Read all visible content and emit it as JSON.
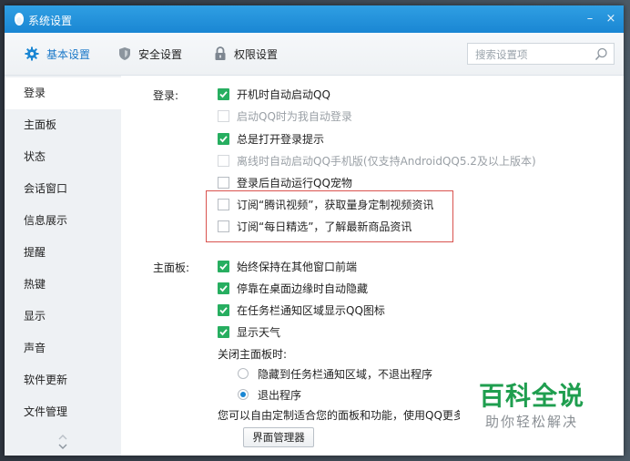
{
  "window": {
    "title": "系统设置",
    "minimize_glyph": "–",
    "close_glyph": "×"
  },
  "tabs": [
    {
      "label": "基本设置",
      "icon": "gear-icon",
      "active": true
    },
    {
      "label": "安全设置",
      "icon": "shield-icon",
      "active": false
    },
    {
      "label": "权限设置",
      "icon": "lock-icon",
      "active": false
    }
  ],
  "search": {
    "placeholder": "搜索设置项",
    "value": ""
  },
  "sidebar": {
    "items": [
      {
        "label": "登录",
        "active": true
      },
      {
        "label": "主面板"
      },
      {
        "label": "状态"
      },
      {
        "label": "会话窗口"
      },
      {
        "label": "信息展示"
      },
      {
        "label": "提醒"
      },
      {
        "label": "热键"
      },
      {
        "label": "显示"
      },
      {
        "label": "声音"
      },
      {
        "label": "软件更新"
      },
      {
        "label": "文件管理"
      }
    ]
  },
  "login": {
    "section_label": "登录:",
    "options": [
      {
        "label": "开机时自动启动QQ",
        "state": "checked"
      },
      {
        "label": "启动QQ时为我自动登录",
        "state": "disabled"
      },
      {
        "label": "总是打开登录提示",
        "state": "checked"
      },
      {
        "label": "离线时自动启动QQ手机版(仅支持AndroidQQ5.2及以上版本)",
        "state": "disabled"
      },
      {
        "label": "登录后自动运行QQ宠物",
        "state": "unchecked"
      },
      {
        "label": "订阅“腾讯视频”，获取量身定制视频资讯",
        "state": "unchecked"
      },
      {
        "label": "订阅“每日精选”，了解最新商品资讯",
        "state": "unchecked"
      }
    ]
  },
  "panel": {
    "section_label": "主面板:",
    "options": [
      {
        "label": "始终保持在其他窗口前端",
        "state": "checked"
      },
      {
        "label": "停靠在桌面边缘时自动隐藏",
        "state": "checked"
      },
      {
        "label": "在任务栏通知区域显示QQ图标",
        "state": "checked"
      },
      {
        "label": "显示天气",
        "state": "checked"
      }
    ],
    "close_label": "关闭主面板时:",
    "close_options": [
      {
        "label": "隐藏到任务栏通知区域，不退出程序",
        "selected": false
      },
      {
        "label": "退出程序",
        "selected": true
      }
    ],
    "customize_text": "您可以自由定制适合您的面板和功能，使用QQ更多",
    "manager_button": "界面管理器"
  },
  "watermark": {
    "brand": "百科全说",
    "sub": "助你轻松解决"
  },
  "colors": {
    "titlebar": "#1a86d3",
    "accent": "#1a78c8",
    "check": "#27ae60",
    "highlight": "#d9534f",
    "watermark": "#1f9e4f"
  }
}
